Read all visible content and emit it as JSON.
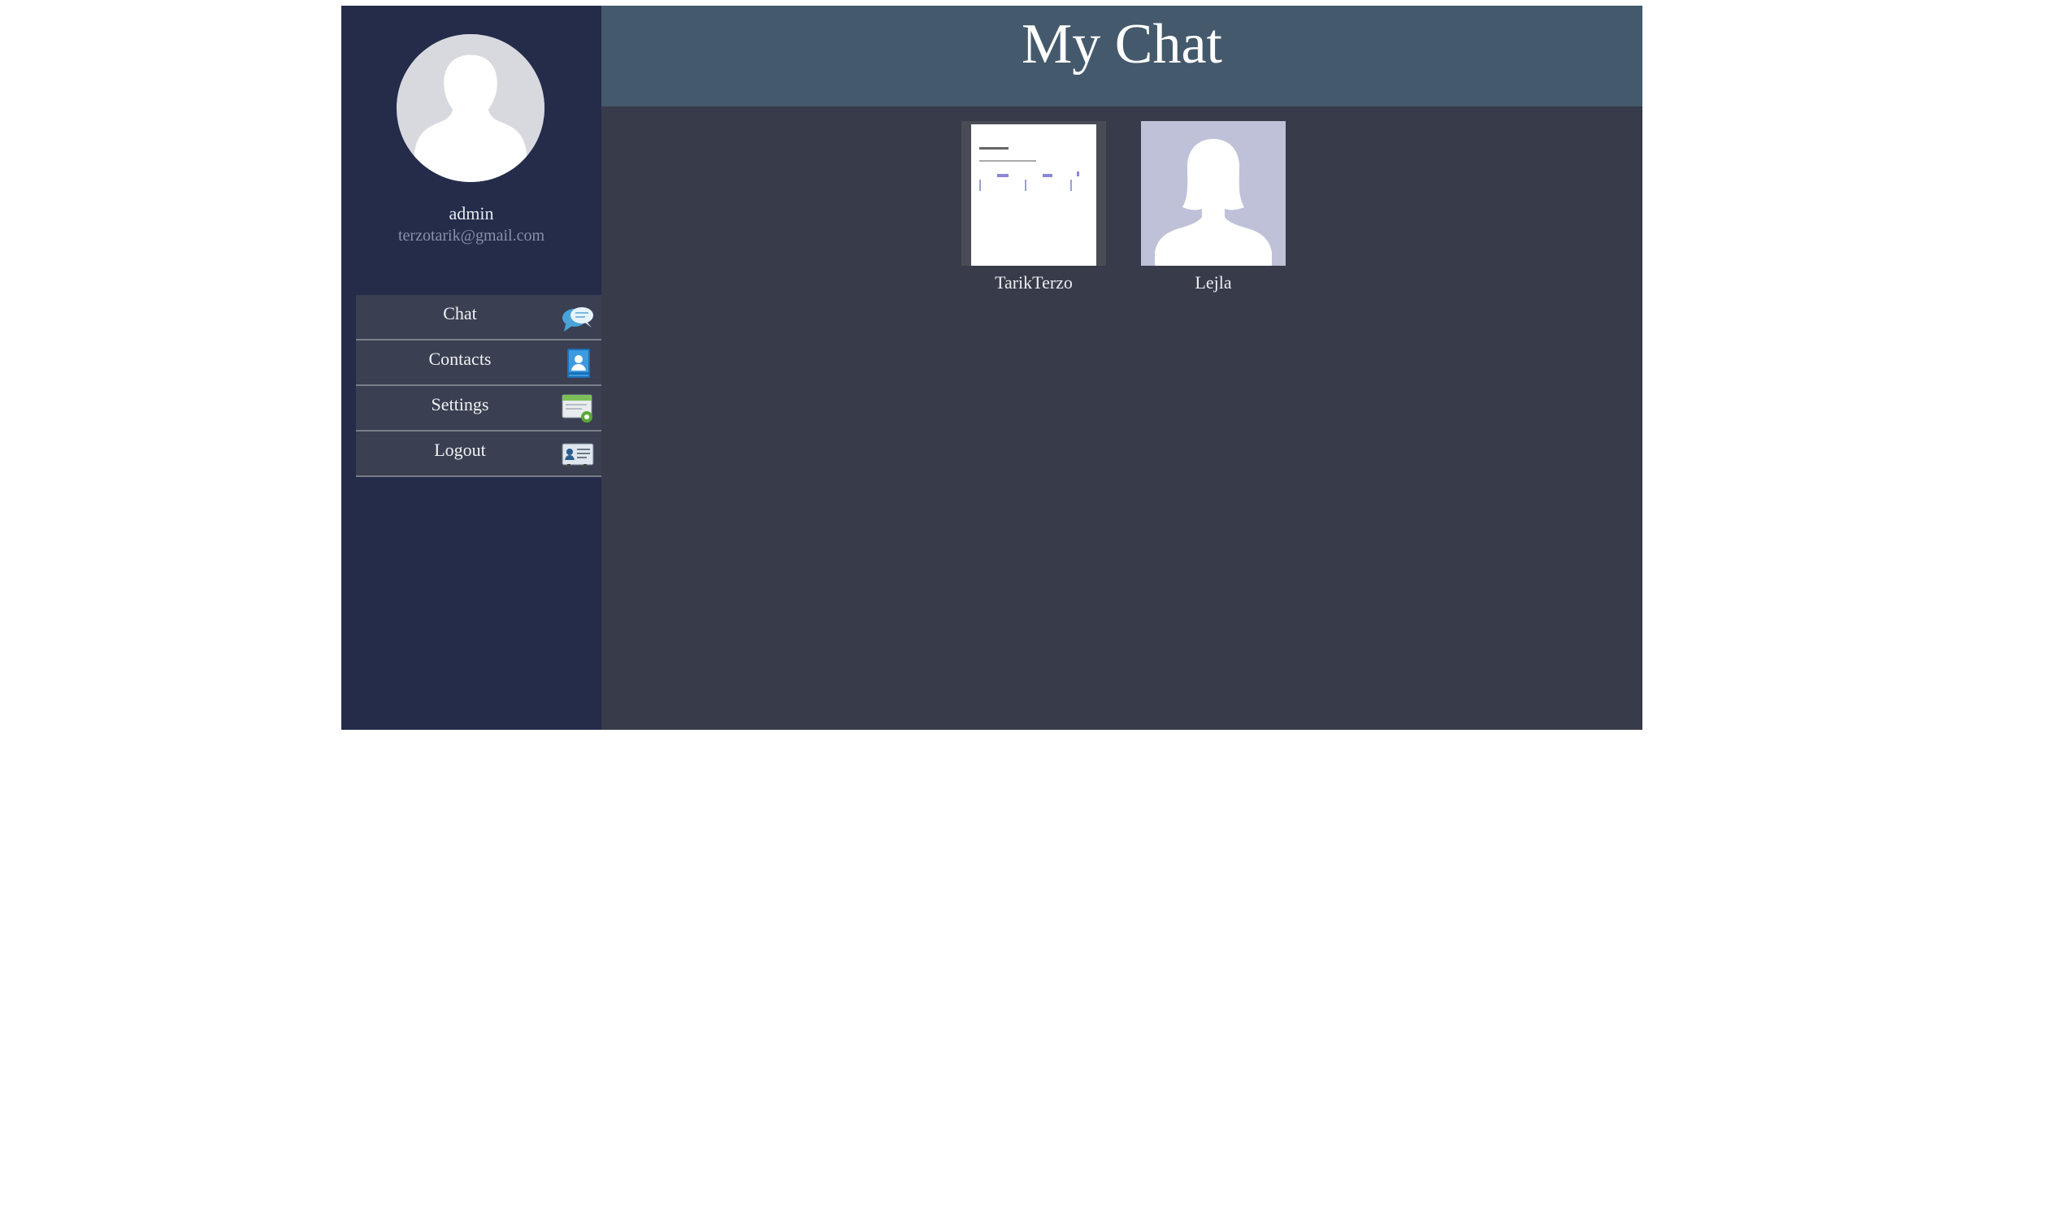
{
  "user": {
    "name": "admin",
    "email": "terzotarik@gmail.com",
    "avatar_icon": "user-silhouette-icon"
  },
  "header": {
    "title": "My Chat"
  },
  "menu": {
    "items": [
      {
        "label": "Chat",
        "icon": "chat-bubbles-icon"
      },
      {
        "label": "Contacts",
        "icon": "contact-card-icon"
      },
      {
        "label": "Settings",
        "icon": "settings-window-icon"
      },
      {
        "label": "Logout",
        "icon": "logout-panel-icon"
      }
    ]
  },
  "contacts": [
    {
      "name": "TarikTerzo",
      "thumb": "document-thumbnail"
    },
    {
      "name": "Lejla",
      "thumb": "female-silhouette-icon"
    }
  ],
  "colors": {
    "sidebar_bg": "#242c4a",
    "header_bg": "#445a6c",
    "main_bg": "#383b49",
    "menu_bg": "#3a4051"
  }
}
